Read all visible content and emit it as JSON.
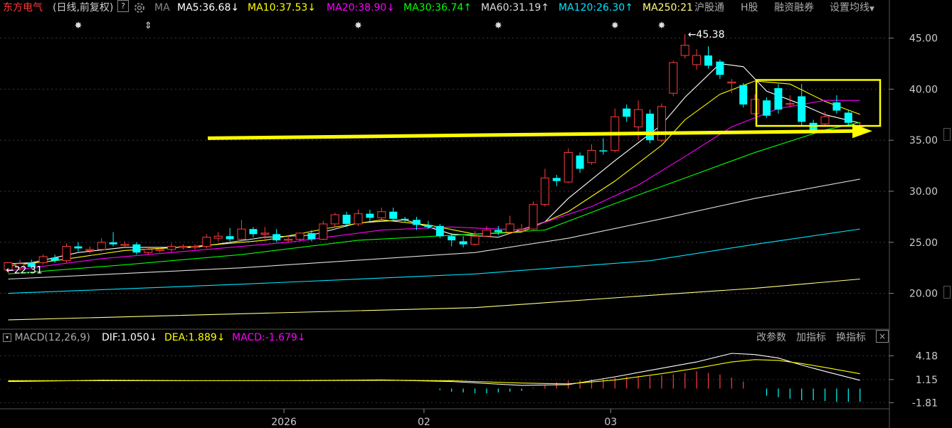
{
  "header": {
    "stock_name": "东方电气",
    "mode": "(日线,前复权)",
    "help_icon": "?",
    "settings_icon": "gear-icon",
    "ma_label": "MA",
    "ma_items": [
      {
        "text": "MA5:36.68",
        "arrow": "↓",
        "color": "#ffffff"
      },
      {
        "text": "MA10:37.53",
        "arrow": "↓",
        "color": "#ffff00"
      },
      {
        "text": "MA20:38.90",
        "arrow": "↓",
        "color": "#ff00ff"
      },
      {
        "text": "MA30:36.74",
        "arrow": "↑",
        "color": "#00ff00"
      },
      {
        "text": "MA60:31.19",
        "arrow": "↑",
        "color": "#dddddd"
      },
      {
        "text": "MA120:26.30",
        "arrow": "↑",
        "color": "#00e5ff"
      },
      {
        "text": "MA250:21",
        "arrow": "",
        "color": "#ffff80"
      }
    ],
    "right_links": [
      "沪股通",
      "H股",
      "融资融券",
      "设置均线"
    ]
  },
  "macd_header": {
    "title": "MACD(12,26,9)",
    "dif": "DIF:1.050",
    "dif_arrow": "↓",
    "dea": "DEA:1.889",
    "dea_arrow": "↓",
    "macd": "MACD:-1.679",
    "macd_arrow": "↓",
    "buttons": [
      "改参数",
      "加指标",
      "换指标"
    ],
    "close": "×"
  },
  "colors": {
    "up": "#ff3b3b",
    "down": "#00ffff",
    "ma5": "#ffffff",
    "ma10": "#ffff00",
    "ma20": "#ff00ff",
    "ma30": "#00ff00",
    "ma60": "#dddddd",
    "ma120": "#00e5ff",
    "ma250": "#ffff80",
    "annotation": "#ffff00"
  },
  "chart_data": {
    "type": "candlestick",
    "price_axis": {
      "ticks": [
        "45.00",
        "40.00",
        "35.00",
        "30.00",
        "25.00",
        "20.00"
      ],
      "range": [
        16.7,
        47.2
      ]
    },
    "x_labels": [
      "2026",
      "02",
      "03"
    ],
    "max_label": "45.38",
    "min_label": "22.31",
    "annotation_line_prices": [
      35.2,
      35.9
    ],
    "highlight_box_prices": [
      36.4,
      40.9
    ],
    "candles": [
      [
        22.3,
        23.0,
        22.8,
        22.0
      ],
      [
        22.5,
        22.9,
        23.3,
        22.2
      ],
      [
        23.0,
        22.6,
        23.3,
        22.4
      ],
      [
        23.0,
        23.6,
        23.8,
        22.8
      ],
      [
        23.5,
        23.2,
        23.8,
        23.0
      ],
      [
        23.2,
        24.6,
        24.9,
        23.0
      ],
      [
        24.6,
        24.4,
        25.0,
        24.1
      ],
      [
        24.3,
        24.3,
        24.6,
        23.9
      ],
      [
        24.3,
        25.0,
        25.4,
        24.1
      ],
      [
        25.0,
        24.8,
        26.0,
        24.6
      ],
      [
        24.8,
        24.8,
        25.1,
        24.5
      ],
      [
        24.8,
        24.0,
        25.0,
        23.8
      ],
      [
        24.0,
        24.3,
        24.6,
        23.8
      ],
      [
        24.2,
        24.3,
        24.5,
        24.0
      ],
      [
        24.3,
        24.6,
        24.9,
        24.0
      ],
      [
        24.6,
        24.6,
        24.8,
        24.3
      ],
      [
        24.5,
        24.6,
        24.8,
        24.3
      ],
      [
        24.6,
        25.5,
        25.8,
        24.4
      ],
      [
        25.4,
        25.6,
        26.0,
        25.1
      ],
      [
        25.6,
        25.3,
        26.4,
        25.1
      ],
      [
        25.3,
        26.3,
        27.2,
        25.0
      ],
      [
        26.3,
        25.8,
        26.5,
        25.5
      ],
      [
        25.8,
        25.9,
        26.5,
        25.3
      ],
      [
        25.8,
        25.2,
        26.3,
        25.0
      ],
      [
        25.2,
        25.3,
        25.7,
        25.0
      ],
      [
        25.3,
        25.9,
        26.0,
        25.1
      ],
      [
        25.9,
        25.3,
        26.2,
        25.1
      ],
      [
        25.3,
        26.8,
        27.1,
        25.2
      ],
      [
        26.8,
        27.7,
        27.9,
        26.5
      ],
      [
        27.7,
        26.8,
        28.0,
        26.5
      ],
      [
        26.8,
        27.8,
        28.2,
        26.6
      ],
      [
        27.8,
        27.4,
        28.2,
        27.1
      ],
      [
        27.4,
        28.0,
        28.4,
        27.2
      ],
      [
        28.0,
        27.3,
        28.4,
        27.1
      ],
      [
        27.3,
        27.2,
        27.5,
        27.0
      ],
      [
        27.2,
        26.7,
        27.5,
        26.2
      ],
      [
        26.7,
        26.5,
        27.1,
        26.3
      ],
      [
        26.6,
        25.6,
        26.8,
        25.4
      ],
      [
        25.6,
        25.2,
        25.9,
        24.6
      ],
      [
        25.1,
        24.8,
        25.6,
        24.5
      ],
      [
        24.8,
        25.6,
        26.1,
        24.7
      ],
      [
        25.6,
        26.2,
        26.6,
        25.6
      ],
      [
        26.2,
        26.0,
        26.6,
        25.7
      ],
      [
        26.0,
        26.8,
        27.6,
        25.8
      ],
      [
        26.3,
        26.3,
        26.8,
        26.0
      ],
      [
        26.3,
        28.7,
        29.0,
        26.2
      ],
      [
        28.7,
        31.3,
        32.2,
        28.5
      ],
      [
        31.3,
        31.0,
        31.6,
        30.5
      ],
      [
        30.9,
        33.8,
        34.2,
        30.8
      ],
      [
        33.5,
        32.2,
        33.8,
        31.8
      ],
      [
        32.8,
        34.0,
        34.6,
        32.6
      ],
      [
        34.0,
        33.9,
        35.2,
        33.6
      ],
      [
        34.0,
        37.3,
        38.1,
        33.8
      ],
      [
        38.1,
        37.3,
        38.5,
        36.8
      ],
      [
        36.3,
        38.0,
        38.9,
        35.0
      ],
      [
        37.6,
        35.0,
        38.0,
        34.7
      ],
      [
        35.0,
        38.3,
        38.6,
        34.8
      ],
      [
        39.6,
        42.6,
        42.8,
        39.3
      ],
      [
        43.3,
        44.3,
        45.38,
        43.0
      ],
      [
        42.4,
        43.3,
        43.9,
        41.9
      ],
      [
        43.3,
        42.3,
        44.2,
        42.0
      ],
      [
        42.7,
        41.4,
        42.9,
        41.0
      ],
      [
        40.7,
        40.7,
        41.0,
        39.6
      ],
      [
        40.4,
        38.5,
        40.6,
        38.2
      ],
      [
        37.6,
        39.0,
        39.5,
        37.4
      ],
      [
        38.9,
        37.4,
        39.2,
        37.2
      ],
      [
        40.1,
        38.0,
        40.5,
        37.6
      ],
      [
        38.6,
        38.6,
        39.4,
        38.2
      ],
      [
        39.3,
        36.8,
        40.5,
        36.4
      ],
      [
        36.7,
        35.9,
        37.0,
        35.6
      ],
      [
        36.6,
        37.3,
        37.8,
        36.4
      ],
      [
        38.7,
        37.9,
        39.4,
        37.6
      ],
      [
        37.7,
        36.7,
        37.9,
        36.5
      ],
      [
        36.4,
        36.4,
        36.8,
        35.8
      ]
    ],
    "ma_series": {
      "ma5": [
        [
          0,
          22.9
        ],
        [
          2,
          23.0
        ],
        [
          6,
          24.0
        ],
        [
          10,
          24.5
        ],
        [
          16,
          24.5
        ],
        [
          22,
          25.5
        ],
        [
          26,
          25.7
        ],
        [
          30,
          26.9
        ],
        [
          34,
          27.2
        ],
        [
          38,
          25.8
        ],
        [
          42,
          25.5
        ],
        [
          46,
          27.0
        ],
        [
          48,
          29.3
        ],
        [
          52,
          33.0
        ],
        [
          56,
          36.5
        ],
        [
          58,
          39.2
        ],
        [
          61,
          42.5
        ],
        [
          63,
          42.2
        ],
        [
          65,
          39.8
        ],
        [
          68,
          38.5
        ],
        [
          70,
          37.5
        ],
        [
          73,
          36.68
        ]
      ],
      "ma10": [
        [
          0,
          22.7
        ],
        [
          4,
          23.2
        ],
        [
          10,
          24.2
        ],
        [
          16,
          24.6
        ],
        [
          22,
          25.2
        ],
        [
          28,
          26.5
        ],
        [
          32,
          27.2
        ],
        [
          36,
          26.7
        ],
        [
          40,
          25.8
        ],
        [
          44,
          26.0
        ],
        [
          48,
          28.0
        ],
        [
          52,
          31.0
        ],
        [
          56,
          34.5
        ],
        [
          58,
          37.0
        ],
        [
          61,
          39.5
        ],
        [
          64,
          40.8
        ],
        [
          67,
          40.5
        ],
        [
          70,
          38.8
        ],
        [
          73,
          37.53
        ]
      ],
      "ma20": [
        [
          0,
          22.2
        ],
        [
          8,
          23.4
        ],
        [
          16,
          24.2
        ],
        [
          24,
          25.0
        ],
        [
          32,
          26.2
        ],
        [
          38,
          26.5
        ],
        [
          44,
          26.2
        ],
        [
          50,
          28.5
        ],
        [
          54,
          30.6
        ],
        [
          58,
          33.4
        ],
        [
          62,
          36.3
        ],
        [
          66,
          38.1
        ],
        [
          70,
          38.9
        ],
        [
          73,
          38.9
        ]
      ],
      "ma30": [
        [
          0,
          21.9
        ],
        [
          10,
          22.8
        ],
        [
          20,
          23.8
        ],
        [
          30,
          25.2
        ],
        [
          40,
          25.8
        ],
        [
          46,
          26.2
        ],
        [
          52,
          28.8
        ],
        [
          58,
          31.3
        ],
        [
          64,
          33.8
        ],
        [
          70,
          36.0
        ],
        [
          73,
          36.74
        ]
      ],
      "ma60": [
        [
          0,
          21.4
        ],
        [
          20,
          22.5
        ],
        [
          40,
          24.0
        ],
        [
          48,
          25.4
        ],
        [
          56,
          27.3
        ],
        [
          64,
          29.3
        ],
        [
          73,
          31.19
        ]
      ],
      "ma120": [
        [
          0,
          20.0
        ],
        [
          20,
          20.9
        ],
        [
          40,
          21.9
        ],
        [
          55,
          23.2
        ],
        [
          64,
          24.8
        ],
        [
          73,
          26.3
        ]
      ],
      "ma250": [
        [
          0,
          17.4
        ],
        [
          20,
          18.0
        ],
        [
          40,
          18.6
        ],
        [
          55,
          19.8
        ],
        [
          64,
          20.5
        ],
        [
          73,
          21.4
        ]
      ]
    },
    "macd_axis": {
      "ticks": [
        "4.18",
        "1.15",
        "-1.81"
      ],
      "range": [
        -2.5,
        5.5
      ]
    },
    "macd": {
      "dif": [
        [
          0,
          0.9
        ],
        [
          8,
          1.05
        ],
        [
          16,
          1.0
        ],
        [
          24,
          1.0
        ],
        [
          32,
          1.1
        ],
        [
          38,
          0.9
        ],
        [
          44,
          0.4
        ],
        [
          48,
          0.5
        ],
        [
          52,
          1.5
        ],
        [
          56,
          2.6
        ],
        [
          59,
          3.4
        ],
        [
          62,
          4.5
        ],
        [
          64,
          4.35
        ],
        [
          66,
          3.9
        ],
        [
          68,
          3.0
        ],
        [
          70,
          2.2
        ],
        [
          73,
          1.05
        ]
      ],
      "dea": [
        [
          0,
          1.0
        ],
        [
          8,
          1.0
        ],
        [
          16,
          1.0
        ],
        [
          24,
          1.0
        ],
        [
          32,
          1.05
        ],
        [
          38,
          1.0
        ],
        [
          44,
          0.7
        ],
        [
          48,
          0.6
        ],
        [
          52,
          1.1
        ],
        [
          56,
          1.9
        ],
        [
          59,
          2.6
        ],
        [
          62,
          3.4
        ],
        [
          64,
          3.7
        ],
        [
          66,
          3.6
        ],
        [
          68,
          3.2
        ],
        [
          70,
          2.7
        ],
        [
          73,
          1.889
        ]
      ],
      "hist": [
        0.05,
        0.08,
        0.08,
        0.05,
        0.05,
        0.05,
        0.05,
        0.05,
        0.05,
        0.05,
        0.04,
        0.04,
        0.03,
        0.03,
        0.03,
        0.03,
        0.03,
        0.03,
        0.03,
        0.03,
        0.03,
        0.03,
        0.03,
        0.03,
        0.03,
        0.03,
        0.03,
        0.03,
        0.03,
        0.03,
        0.03,
        0.03,
        0.03,
        0.03,
        0.03,
        0.03,
        0.03,
        -0.2,
        -0.4,
        -0.5,
        -0.6,
        -0.6,
        -0.5,
        -0.4,
        -0.3,
        0.1,
        0.4,
        0.8,
        1.0,
        1.1,
        1.2,
        1.3,
        1.4,
        1.5,
        1.6,
        1.6,
        1.7,
        1.8,
        2.0,
        2.2,
        2.0,
        1.8,
        1.4,
        0.9,
        0.0,
        -0.9,
        -1.1,
        -1.3,
        -1.5,
        -1.5,
        -1.6,
        -1.7,
        -1.7,
        -1.679
      ]
    }
  }
}
